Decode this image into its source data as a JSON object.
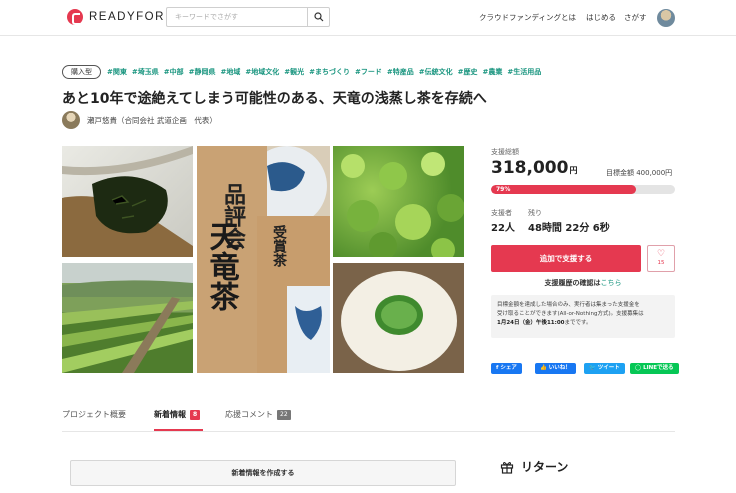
{
  "header": {
    "logo_text": "READYFOR",
    "search_placeholder": "キーワードでさがす",
    "nav": [
      "クラウドファンディングとは",
      "はじめる",
      "さがす"
    ]
  },
  "project": {
    "type_badge": "購入型",
    "tags": [
      "#関東",
      "#埼玉県",
      "#中部",
      "#静岡県",
      "#地域",
      "#地域文化",
      "#観光",
      "#まちづくり",
      "#フード",
      "#特産品",
      "#伝統文化",
      "#歴史",
      "#農業",
      "#生活用品"
    ],
    "title": "あと10年で途絶えてしまう可能性のある、天竜の浅蒸し茶を存続へ",
    "owner": "瀬戸悠貴（合同会社 武道企画　代表）"
  },
  "photos": [
    {
      "name": "tea-leaves-photo"
    },
    {
      "name": "tea-field-photo"
    },
    {
      "name": "tea-box-photo",
      "box_text_top": "品評会",
      "box_text_mid": "天竜茶",
      "box_text_side": "受賞茶"
    },
    {
      "name": "tea-plants-photo"
    },
    {
      "name": "green-tea-cup-photo"
    }
  ],
  "funding": {
    "total_label": "支援総額",
    "amount": "318,000",
    "amount_unit": "円",
    "goal_text": "目標金額 400,000円",
    "progress_percent": 79,
    "progress_label": "79%",
    "supporters_label": "支援者",
    "supporters": "22人",
    "remaining_label": "残り",
    "remaining": "48時間 22分 6秒",
    "support_button": "追加で支援する",
    "favorite_count": "15",
    "history_text": "支援履歴の確認は",
    "history_link": "こちら",
    "note_line1": "目標金額を達成した場合のみ、実行者は集まった支援金を",
    "note_line2": "受け取ることができます(All-or-Nothing方式)。支援募集は",
    "note_line3_bold": "1月24日（金）午後11:00",
    "note_line3_tail": "までです。"
  },
  "share": {
    "facebook": "シェア",
    "like": "いいね！",
    "twitter": "ツイート",
    "line": "LINEで送る"
  },
  "colors": {
    "accent": "#e53950",
    "tag": "#19957f",
    "facebook": "#1877f2",
    "twitter": "#1da1f2",
    "line": "#06c755"
  },
  "tabs": [
    {
      "label": "プロジェクト概要"
    },
    {
      "label": "新着情報",
      "count": "8"
    },
    {
      "label": "応援コメント",
      "count": "22"
    }
  ],
  "updates": {
    "create_button": "新着情報を作成する"
  },
  "returns": {
    "heading": "リターン"
  }
}
